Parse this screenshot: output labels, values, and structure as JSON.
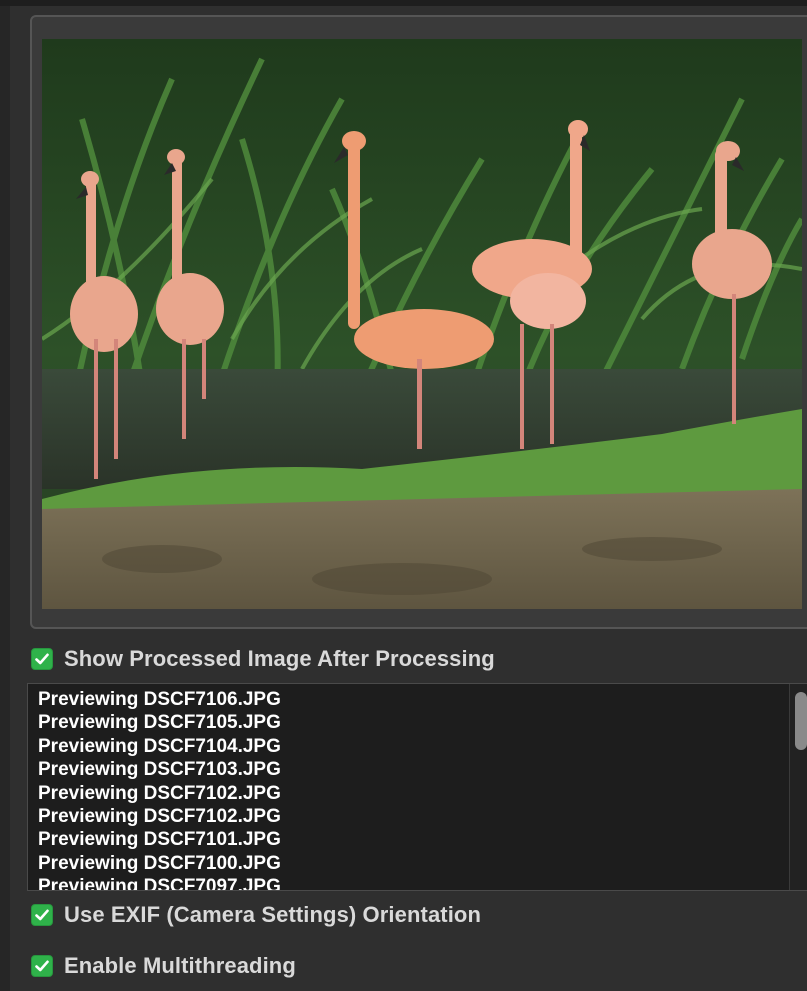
{
  "preview": {
    "image_alt": "Flamingos standing in a pond beside grass and plants"
  },
  "options": {
    "show_processed": {
      "label": "Show Processed Image After Processing",
      "checked": true
    },
    "use_exif": {
      "label": "Use EXIF (Camera Settings) Orientation",
      "checked": true
    },
    "multithreading": {
      "label": "Enable Multithreading",
      "checked": true
    }
  },
  "log": {
    "lines": [
      "Previewing DSCF7106.JPG",
      "Previewing DSCF7105.JPG",
      "Previewing DSCF7104.JPG",
      "Previewing DSCF7103.JPG",
      "Previewing DSCF7102.JPG",
      "Previewing DSCF7102.JPG",
      "Previewing DSCF7101.JPG",
      "Previewing DSCF7100.JPG",
      "Previewing DSCF7097.JPG"
    ]
  },
  "colors": {
    "checkbox_checked": "#2fb24a",
    "log_background": "#1d1d1d",
    "panel_background": "#2f2f2f"
  },
  "icons": {
    "checkbox": "checkmark-icon"
  }
}
